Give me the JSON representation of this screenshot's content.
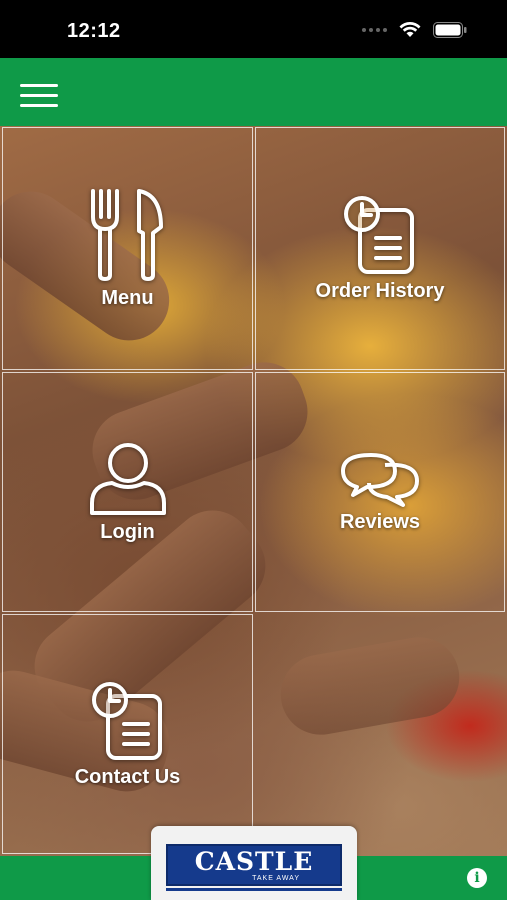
{
  "status_bar": {
    "time": "12:12"
  },
  "header": {
    "menu_icon": "hamburger-icon"
  },
  "tiles": [
    {
      "label": "Menu",
      "icon": "fork-knife-icon"
    },
    {
      "label": "Order History",
      "icon": "clock-document-icon"
    },
    {
      "label": "Login",
      "icon": "user-icon"
    },
    {
      "label": "Reviews",
      "icon": "chat-bubbles-icon"
    },
    {
      "label": "Contact Us",
      "icon": "clock-document-icon"
    }
  ],
  "footer": {
    "logo_text": "CASTLE",
    "logo_subtext": "TAKE AWAY",
    "info_icon": "info-icon"
  },
  "colors": {
    "brand_green": "#0f9a48",
    "logo_blue": "#153a8c"
  }
}
